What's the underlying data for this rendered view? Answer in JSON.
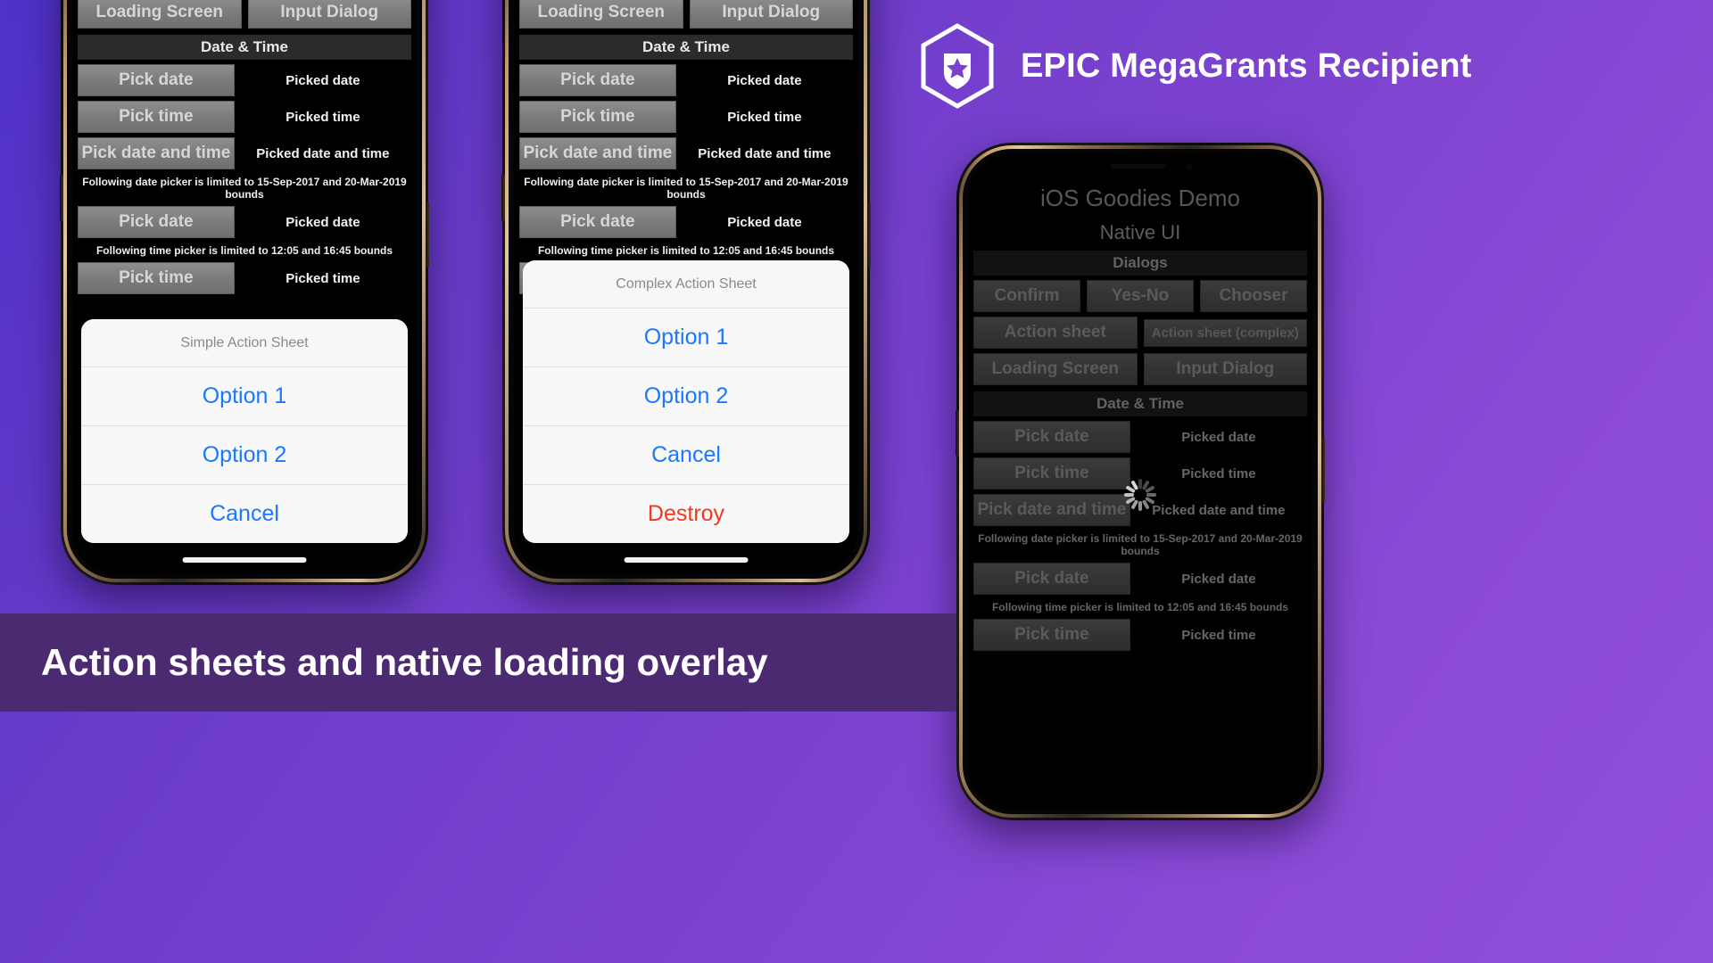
{
  "background": {
    "gradient_from": "#4f32c9",
    "gradient_to": "#9150dc"
  },
  "caption": {
    "text": "Action sheets and native loading overlay",
    "bar_color": "#4c2a72"
  },
  "epic_badge": {
    "label": "EPIC MegaGrants Recipient",
    "icon": "hexagon-shield-star-icon",
    "color": "#ffffff"
  },
  "app": {
    "title": "iOS Goodies Demo",
    "subtitle": "Native UI",
    "sections": {
      "dialogs": "Dialogs",
      "date_time": "Date & Time"
    },
    "buttons": {
      "confirm": "Confirm",
      "yes_no": "Yes-No",
      "chooser": "Chooser",
      "action_sheet": "Action sheet",
      "action_sheet_complex": "Action sheet (complex)",
      "loading_screen": "Loading Screen",
      "input_dialog": "Input Dialog",
      "pick_date": "Pick date",
      "pick_time": "Pick time",
      "pick_date_and_time": "Pick date and time"
    },
    "values": {
      "picked_date": "Picked date",
      "picked_time": "Picked time",
      "picked_date_and_time": "Picked date and time"
    },
    "notes": {
      "date_bounds": "Following date picker is limited to 15-Sep-2017 and 20-Mar-2019 bounds",
      "time_bounds": "Following time picker is limited to 12:05 and 16:45 bounds"
    }
  },
  "phone1": {
    "action_sheet": {
      "title": "Simple Action Sheet",
      "options": [
        {
          "label": "Option 1",
          "style": "default"
        },
        {
          "label": "Option 2",
          "style": "default"
        },
        {
          "label": "Cancel",
          "style": "cancel"
        }
      ]
    }
  },
  "phone2": {
    "action_sheet": {
      "title": "Complex Action Sheet",
      "options": [
        {
          "label": "Option 1",
          "style": "default"
        },
        {
          "label": "Option 2",
          "style": "default"
        },
        {
          "label": "Cancel",
          "style": "cancel"
        },
        {
          "label": "Destroy",
          "style": "destructive"
        }
      ]
    }
  },
  "phone3": {
    "overlay": {
      "type": "native-loading-overlay",
      "spinner": "activity-indicator-icon"
    }
  },
  "colors": {
    "ios_blue": "#1a78ff",
    "ios_red": "#f4381f",
    "sheet_bg": "#f6f6f6",
    "sheet_title": "#8a8a8e",
    "button_gray": "#7b7b7b",
    "section_header": "#2b2b2b"
  }
}
